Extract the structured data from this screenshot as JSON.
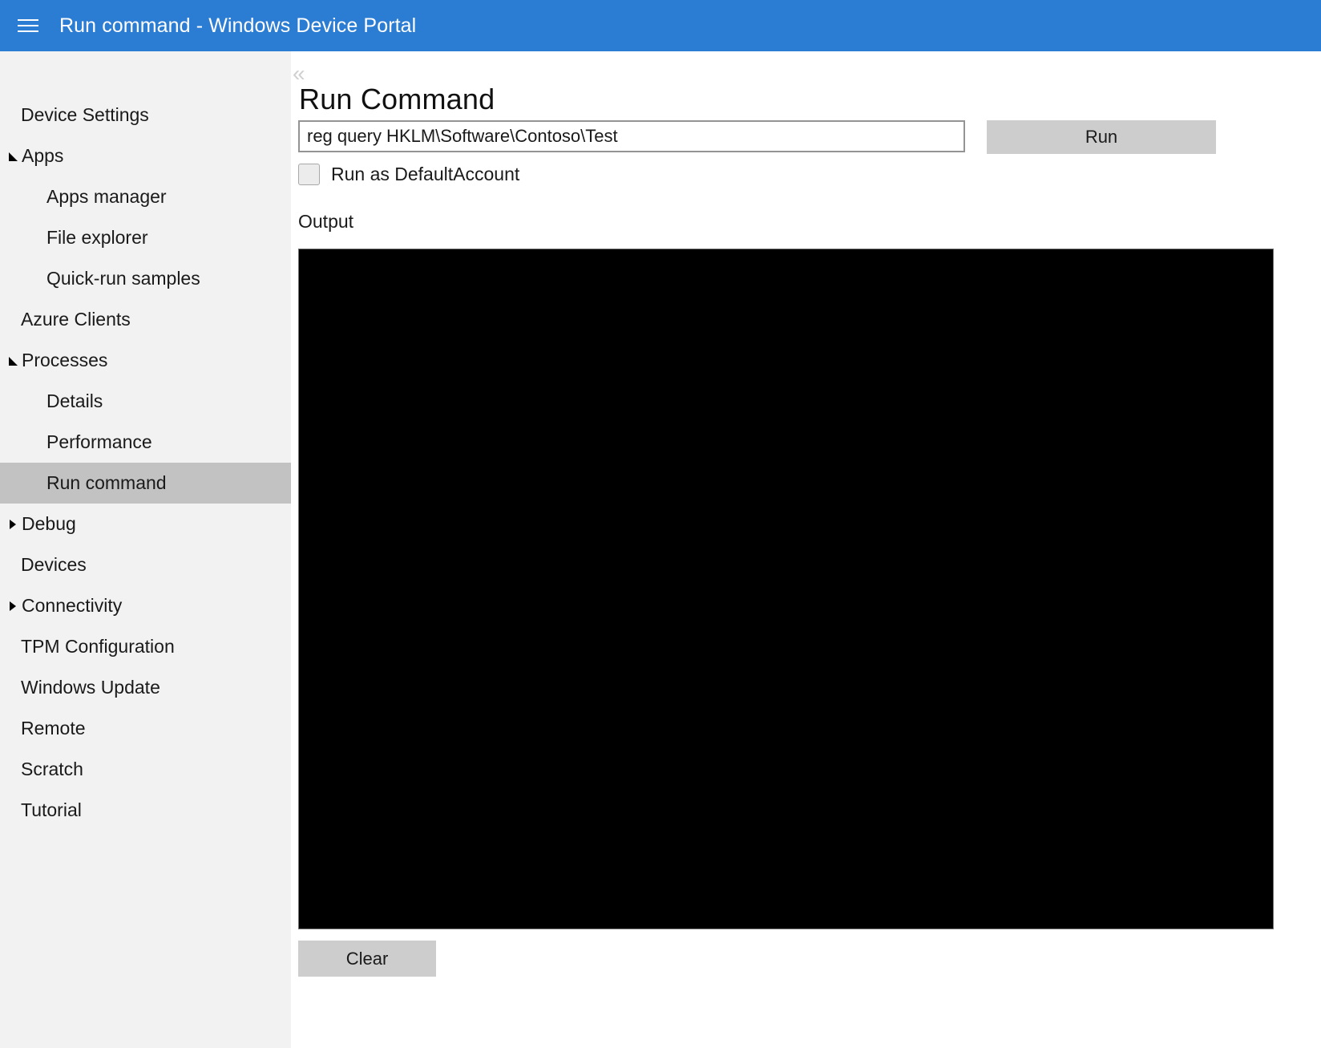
{
  "titlebar": {
    "menu_icon": "hamburger-icon",
    "title": "Run command - Windows Device Portal",
    "background_color": "#2b7cd3"
  },
  "sidebar": {
    "background_color": "#f2f2f2",
    "selected_color": "#c2c2c2",
    "items": [
      {
        "label": "Device Settings",
        "level": 0,
        "arrow": "none",
        "selected": false
      },
      {
        "label": "Apps",
        "level": 0,
        "arrow": "expanded",
        "selected": false
      },
      {
        "label": "Apps manager",
        "level": 1,
        "arrow": "none",
        "selected": false
      },
      {
        "label": "File explorer",
        "level": 1,
        "arrow": "none",
        "selected": false
      },
      {
        "label": "Quick-run samples",
        "level": 1,
        "arrow": "none",
        "selected": false
      },
      {
        "label": "Azure Clients",
        "level": 0,
        "arrow": "none",
        "selected": false
      },
      {
        "label": "Processes",
        "level": 0,
        "arrow": "expanded",
        "selected": false
      },
      {
        "label": "Details",
        "level": 1,
        "arrow": "none",
        "selected": false
      },
      {
        "label": "Performance",
        "level": 1,
        "arrow": "none",
        "selected": false
      },
      {
        "label": "Run command",
        "level": 1,
        "arrow": "none",
        "selected": true
      },
      {
        "label": "Debug",
        "level": 0,
        "arrow": "collapsed",
        "selected": false
      },
      {
        "label": "Devices",
        "level": 0,
        "arrow": "none",
        "selected": false
      },
      {
        "label": "Connectivity",
        "level": 0,
        "arrow": "collapsed",
        "selected": false
      },
      {
        "label": "TPM Configuration",
        "level": 0,
        "arrow": "none",
        "selected": false
      },
      {
        "label": "Windows Update",
        "level": 0,
        "arrow": "none",
        "selected": false
      },
      {
        "label": "Remote",
        "level": 0,
        "arrow": "none",
        "selected": false
      },
      {
        "label": "Scratch",
        "level": 0,
        "arrow": "none",
        "selected": false
      },
      {
        "label": "Tutorial",
        "level": 0,
        "arrow": "none",
        "selected": false
      }
    ]
  },
  "main": {
    "collapse_icon": "«",
    "page_title": "Run Command",
    "command_input": {
      "value": "reg query HKLM\\Software\\Contoso\\Test",
      "placeholder": ""
    },
    "run_button_label": "Run",
    "checkbox": {
      "label": "Run as DefaultAccount",
      "checked": false
    },
    "output_label": "Output",
    "output_text": "",
    "clear_button_label": "Clear"
  }
}
